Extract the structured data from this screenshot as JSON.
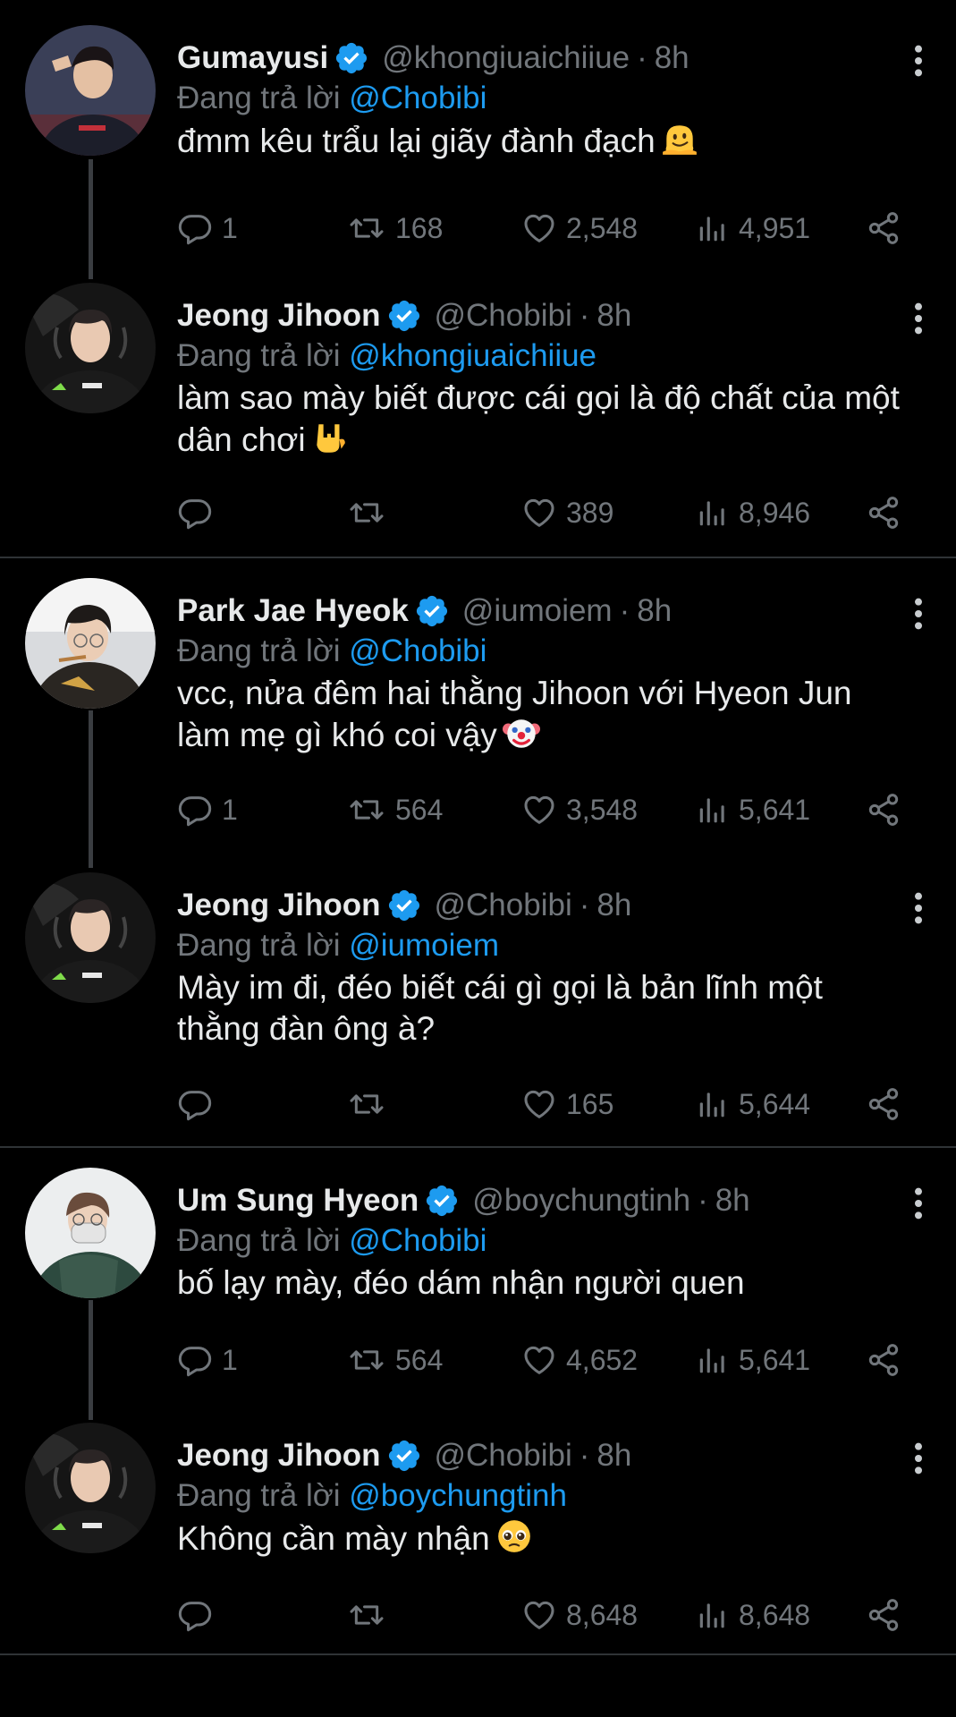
{
  "tweets": [
    {
      "name": "Gumayusi",
      "handle": "@khongiuaichiiue",
      "time": "8h",
      "reply_prefix": "Đang trả lời",
      "reply_to": "@Chobibi",
      "text": "đmm kêu trẩu lại giãy đành đạch",
      "emoji": "melting-face-icon",
      "replies": "1",
      "retweets": "168",
      "likes": "2,548",
      "views": "4,951",
      "avatar": "avatar-gumayusi"
    },
    {
      "name": "Jeong Jihoon",
      "handle": "@Chobibi",
      "time": "8h",
      "reply_prefix": "Đang trả lời",
      "reply_to": "@khongiuaichiiue",
      "text": "làm sao mày biết được cái gọi là độ chất của một dân chơi",
      "emoji": "rock-hand-icon",
      "replies": "",
      "retweets": "",
      "likes": "389",
      "views": "8,946",
      "avatar": "avatar-jeong-jihoon"
    },
    {
      "name": "Park Jae Hyeok",
      "handle": "@iumoiem",
      "time": "8h",
      "reply_prefix": "Đang trả lời",
      "reply_to": "@Chobibi",
      "text": "vcc, nửa đêm hai thằng Jihoon với Hyeon Jun làm mẹ gì khó coi vậy",
      "emoji": "clown-face-icon",
      "replies": "1",
      "retweets": "564",
      "likes": "3,548",
      "views": "5,641",
      "avatar": "avatar-park-jae-hyeok"
    },
    {
      "name": "Jeong Jihoon",
      "handle": "@Chobibi",
      "time": "8h",
      "reply_prefix": "Đang trả lời",
      "reply_to": "@iumoiem",
      "text": "Mày im đi, đéo biết cái gì gọi là bản lĩnh một thằng đàn ông à?",
      "emoji": "",
      "replies": "",
      "retweets": "",
      "likes": "165",
      "views": "5,644",
      "avatar": "avatar-jeong-jihoon"
    },
    {
      "name": "Um Sung Hyeon",
      "handle": "@boychungtinh",
      "time": "8h",
      "reply_prefix": "Đang trả lời",
      "reply_to": "@Chobibi",
      "text": "bố lạy mày, đéo dám nhận người quen",
      "emoji": "",
      "replies": "1",
      "retweets": "564",
      "likes": "4,652",
      "views": "5,641",
      "avatar": "avatar-um-sung-hyeon"
    },
    {
      "name": "Jeong Jihoon",
      "handle": "@Chobibi",
      "time": "8h",
      "reply_prefix": "Đang trả lời",
      "reply_to": "@boychungtinh",
      "text": "Không cần mày nhận",
      "emoji": "pleading-face-icon",
      "replies": "",
      "retweets": "",
      "likes": "8,648",
      "views": "8,648",
      "avatar": "avatar-jeong-jihoon"
    }
  ],
  "colors": {
    "background": "#000000",
    "text": "#e7e9ea",
    "muted": "#71767b",
    "accent": "#1d9bf0",
    "separator": "#2f3336"
  }
}
